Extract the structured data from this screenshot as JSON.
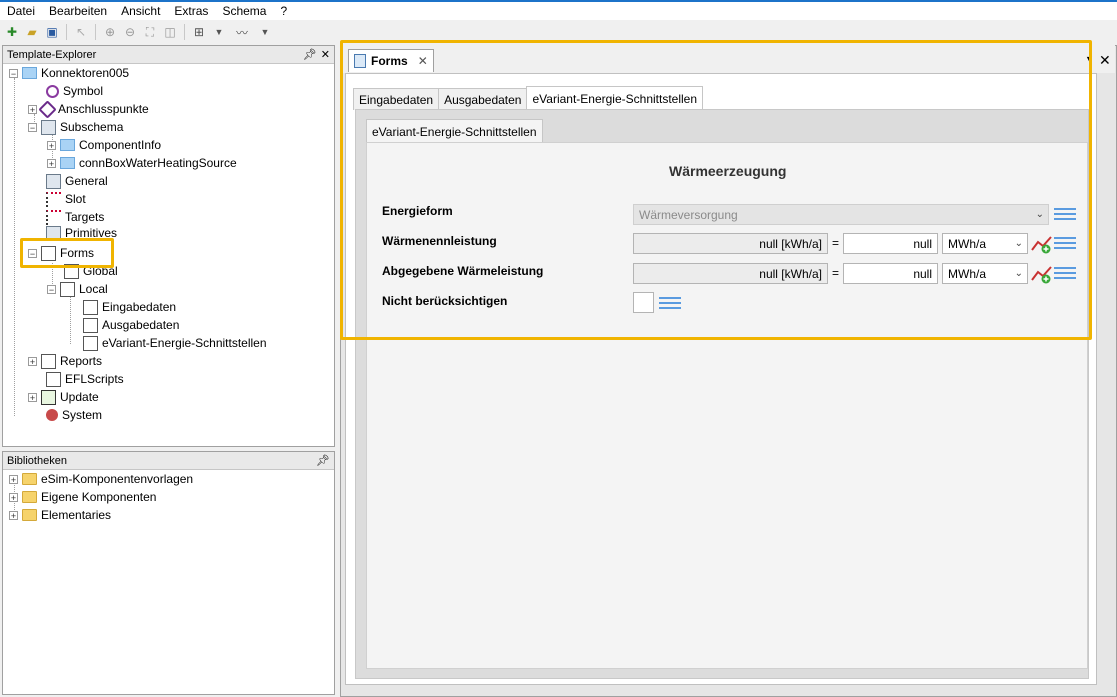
{
  "menu": [
    "Datei",
    "Bearbeiten",
    "Ansicht",
    "Extras",
    "Schema",
    "?"
  ],
  "explorer": {
    "title": "Template-Explorer",
    "root": "Konnektoren005",
    "items": {
      "symbol": "Symbol",
      "anschluss": "Anschlusspunkte",
      "subschema": "Subschema",
      "componentinfo": "ComponentInfo",
      "connbox": "connBoxWaterHeatingSource",
      "general": "General",
      "slot": "Slot",
      "targets": "Targets",
      "primitives": "Primitives",
      "forms": "Forms",
      "global": "Global",
      "local": "Local",
      "eingabedaten": "Eingabedaten",
      "ausgabedaten": "Ausgabedaten",
      "evariant": "eVariant-Energie-Schnittstellen",
      "reports": "Reports",
      "eflscripts": "EFLScripts",
      "update": "Update",
      "system": "System"
    }
  },
  "libraries": {
    "title": "Bibliotheken",
    "items": [
      "eSim-Komponentenvorlagen",
      "Eigene Komponenten",
      "Elementaries"
    ]
  },
  "document": {
    "tab_label": "Forms",
    "tabs": [
      "Eingabedaten",
      "Ausgabedaten",
      "eVariant-Energie-Schnittstellen"
    ],
    "subtab": "eVariant-Energie-Schnittstellen",
    "heading": "Wärmeerzeugung",
    "rows": {
      "energieform": {
        "label": "Energieform",
        "value": "Wärmeversorgung"
      },
      "waermenenn": {
        "label": "Wärmenennleistung",
        "readonly": "null [kWh/a]",
        "eq": "=",
        "input": "null",
        "unit": "MWh/a"
      },
      "abgegeben": {
        "label": "Abgegebene Wärmeleistung",
        "readonly": "null [kWh/a]",
        "eq": "=",
        "input": "null",
        "unit": "MWh/a"
      },
      "nicht": {
        "label": "Nicht berücksichtigen"
      }
    }
  },
  "colors": {
    "highlight": "#f0b400",
    "accent": "#1c73c9"
  }
}
